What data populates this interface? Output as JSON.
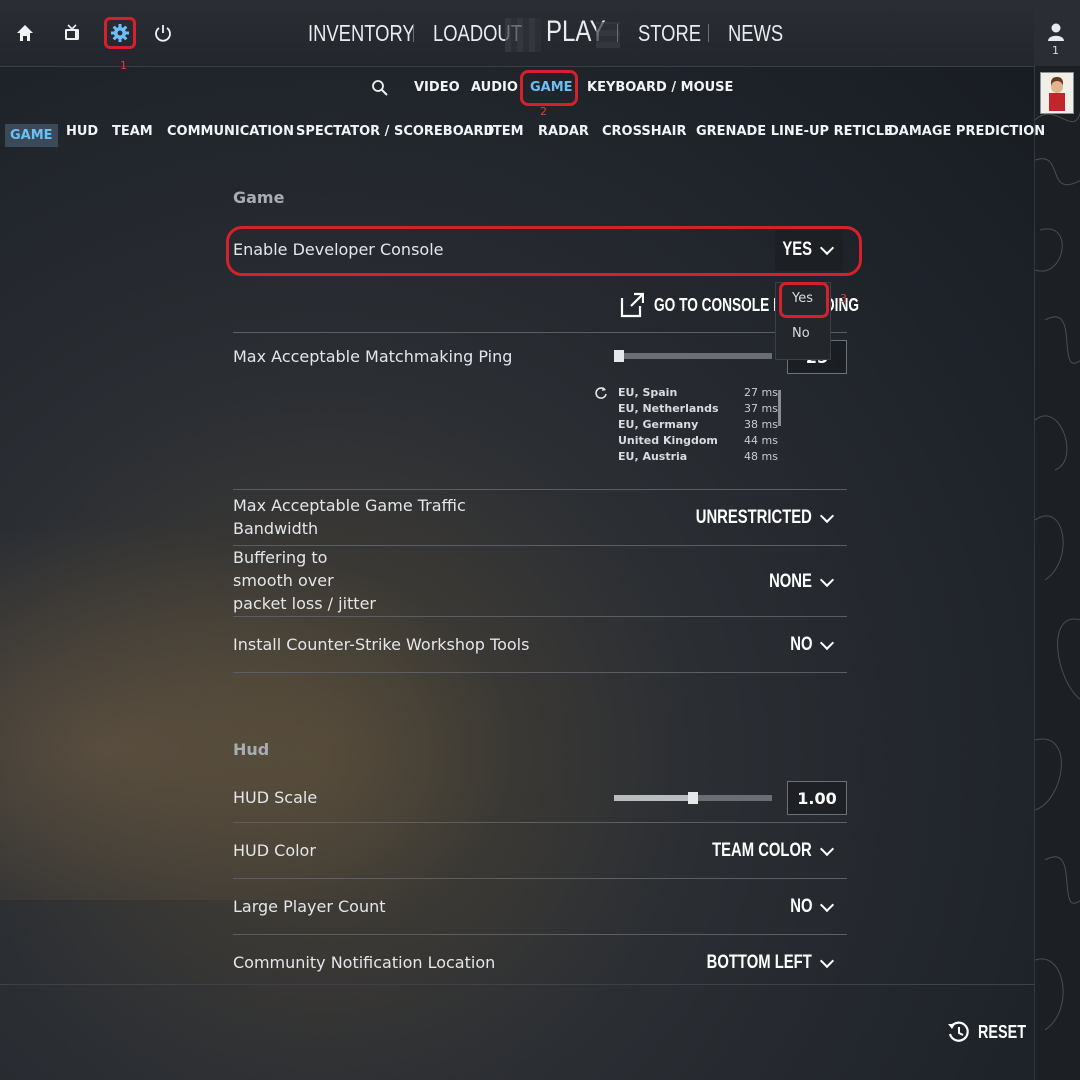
{
  "topbar": {
    "icons": [
      "home-icon",
      "tv-icon",
      "gear-icon",
      "power-icon"
    ],
    "nav": {
      "inventory": "INVENTORY",
      "loadout": "LOADOUT",
      "play": "PLAY",
      "store": "STORE",
      "news": "NEWS"
    },
    "friends_count": "1"
  },
  "settings_tabs": {
    "video": "VIDEO",
    "audio": "AUDIO",
    "game": "GAME",
    "keyboard_mouse": "KEYBOARD / MOUSE",
    "active": "GAME"
  },
  "category_tabs": [
    "GAME",
    "HUD",
    "TEAM",
    "COMMUNICATION",
    "SPECTATOR / SCOREBOARD",
    "ITEM",
    "RADAR",
    "CROSSHAIR",
    "GRENADE LINE-UP RETICLE",
    "DAMAGE PREDICTION"
  ],
  "annotations": [
    "1",
    "2",
    "3"
  ],
  "game_section": {
    "title": "Game",
    "dev_console": {
      "label": "Enable Developer Console",
      "value": "YES",
      "options": [
        "Yes",
        "No"
      ]
    },
    "console_link": "GO TO CONSOLE KEYBINDING",
    "ping": {
      "label": "Max Acceptable Matchmaking Ping",
      "value": "25",
      "slider_fraction": 0.0,
      "servers": [
        {
          "name": "EU, Spain",
          "ms": "27 ms"
        },
        {
          "name": "EU, Netherlands",
          "ms": "37 ms"
        },
        {
          "name": "EU, Germany",
          "ms": "38 ms"
        },
        {
          "name": "United Kingdom",
          "ms": "44 ms"
        },
        {
          "name": "EU, Austria",
          "ms": "48 ms"
        }
      ]
    },
    "bandwidth": {
      "label_line1": "Max Acceptable Game Traffic",
      "label_line2": "Bandwidth",
      "value": "UNRESTRICTED"
    },
    "buffering": {
      "label_line1": "Buffering to",
      "label_line2": "smooth over",
      "label_line3": "packet loss / jitter",
      "value": "NONE"
    },
    "workshop": {
      "label": "Install Counter-Strike Workshop Tools",
      "value": "NO"
    }
  },
  "hud_section": {
    "title": "Hud",
    "scale": {
      "label": "HUD Scale",
      "value": "1.00",
      "slider_fraction": 0.5
    },
    "color": {
      "label": "HUD Color",
      "value": "TEAM COLOR"
    },
    "large_player_count": {
      "label": "Large Player Count",
      "value": "NO"
    },
    "community_notification": {
      "label": "Community Notification Location",
      "value": "BOTTOM LEFT"
    }
  },
  "reset_label": "RESET",
  "colors": {
    "accent": "#6cc0f5",
    "annotation": "#d6202b"
  }
}
